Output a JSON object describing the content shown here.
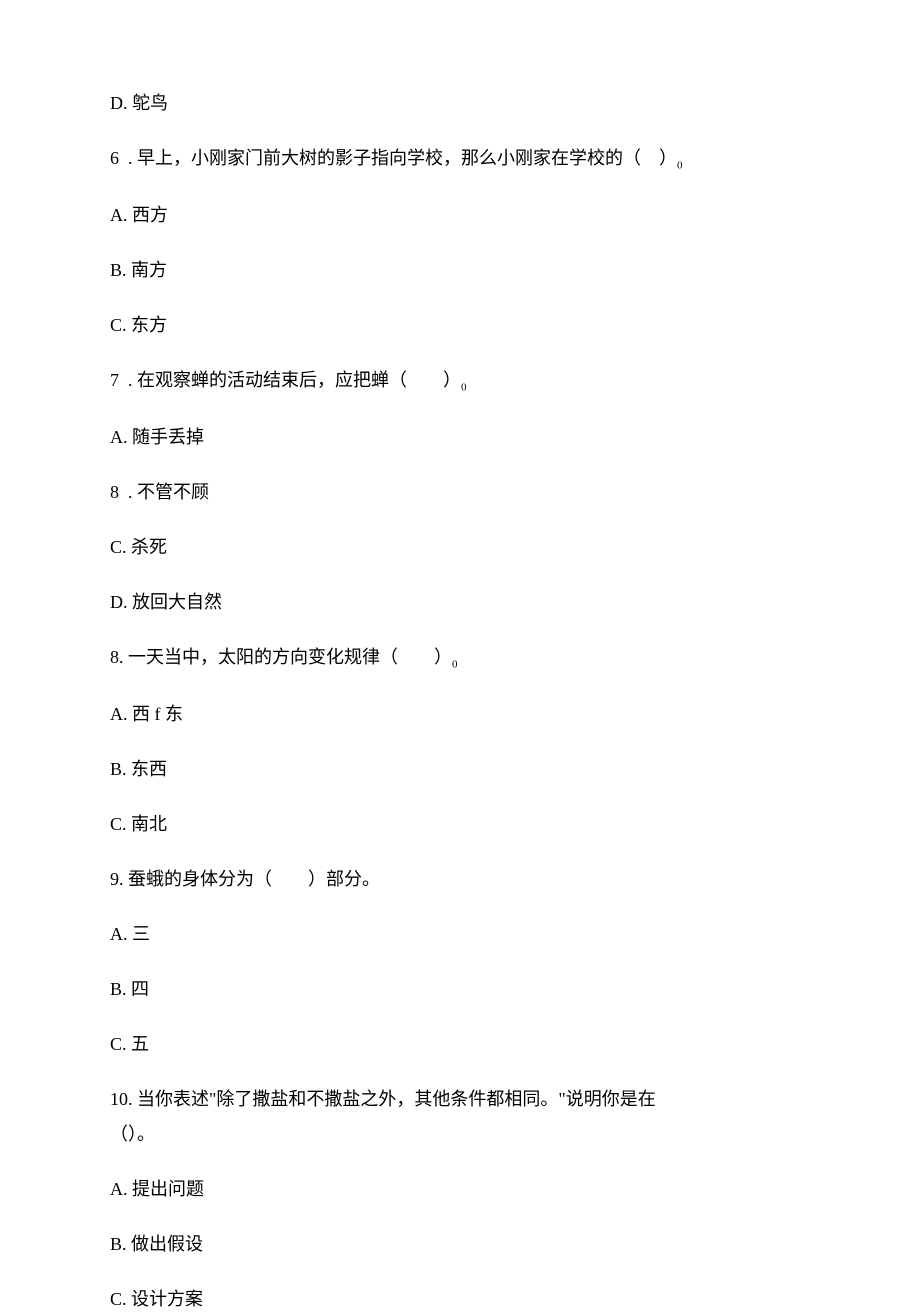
{
  "items": [
    {
      "text": "D. 鸵鸟",
      "compact": false
    },
    {
      "text": "6  . 早上，小刚家门前大树的影子指向学校，那么小刚家在学校的（　）",
      "sub": "0",
      "compact": false
    },
    {
      "text": "A. 西方",
      "compact": false
    },
    {
      "text": "B. 南方",
      "compact": false
    },
    {
      "text": "C. 东方",
      "compact": false
    },
    {
      "text": "7  . 在观察蝉的活动结束后，应把蝉（　　）",
      "sub": "0",
      "compact": false
    },
    {
      "text": "A. 随手丢掉",
      "compact": false
    },
    {
      "text": "8  . 不管不顾",
      "compact": false
    },
    {
      "text": "C. 杀死",
      "compact": false
    },
    {
      "text": "D. 放回大自然",
      "compact": false
    },
    {
      "text": "8. 一天当中，太阳的方向变化规律（　　）",
      "sub": "0",
      "compact": false
    },
    {
      "text": "A. 西 f 东",
      "compact": false
    },
    {
      "text": "B. 东西",
      "compact": false
    },
    {
      "text": "C. 南北",
      "compact": false
    },
    {
      "text": "9. 蚕蛾的身体分为（　　）部分。",
      "compact": false
    },
    {
      "text": "A. 三",
      "compact": false
    },
    {
      "text": "B. 四",
      "compact": false
    },
    {
      "text": "C. 五",
      "compact": false
    },
    {
      "text": "10. 当你表述\"除了撒盐和不撒盐之外，其他条件都相同。\"说明你是在",
      "compact": true
    },
    {
      "text": "（）。",
      "compact": false
    },
    {
      "text": "A. 提出问题",
      "compact": false
    },
    {
      "text": "B. 做出假设",
      "compact": false
    },
    {
      "text": "C. 设计方案",
      "compact": false
    }
  ]
}
